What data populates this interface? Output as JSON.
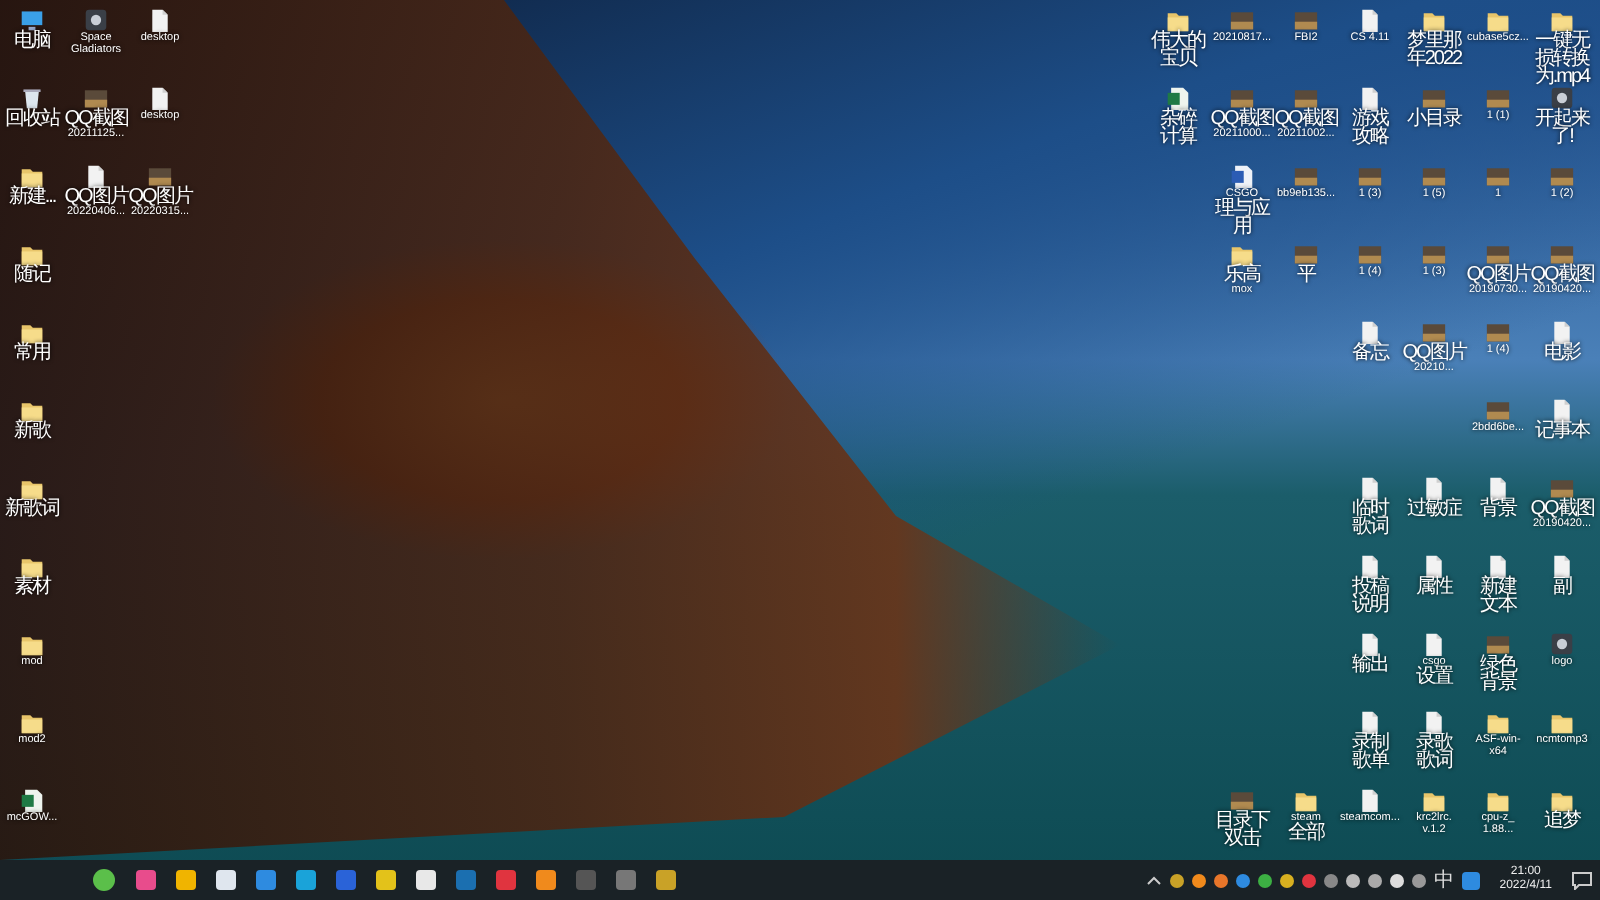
{
  "desktop": {
    "left_rows": [
      [
        {
          "kind": "pc",
          "label": [
            "电脑"
          ]
        },
        {
          "kind": "app",
          "label": [
            "Space",
            "Gladiators"
          ]
        },
        {
          "kind": "file",
          "label": [
            "desktop"
          ]
        }
      ],
      [
        {
          "kind": "bin",
          "label": [
            "回收站"
          ]
        },
        {
          "kind": "image",
          "label": [
            "QQ截图",
            "20211125..."
          ]
        },
        {
          "kind": "file",
          "label": [
            "desktop"
          ]
        }
      ],
      [
        {
          "kind": "folder",
          "label": [
            "新建..."
          ]
        },
        {
          "kind": "file",
          "label": [
            "QQ图片",
            "20220406..."
          ]
        },
        {
          "kind": "image",
          "label": [
            "QQ图片",
            "20220315..."
          ]
        }
      ],
      [
        {
          "kind": "folder",
          "label": [
            "随记"
          ]
        }
      ],
      [
        {
          "kind": "folder",
          "label": [
            "常用"
          ]
        }
      ],
      [
        {
          "kind": "folder",
          "label": [
            "新歌"
          ]
        }
      ],
      [
        {
          "kind": "folder",
          "label": [
            "新歌词"
          ]
        }
      ],
      [
        {
          "kind": "folder",
          "label": [
            "素材"
          ]
        }
      ],
      [
        {
          "kind": "folder",
          "label": [
            "mod"
          ]
        }
      ],
      [
        {
          "kind": "folder",
          "label": [
            "mod2"
          ]
        }
      ],
      [
        {
          "kind": "excel",
          "label": [
            "mcGOW..."
          ]
        }
      ]
    ],
    "right_rows": [
      [
        {
          "kind": "folder",
          "label": [
            "伟大的",
            "宝贝"
          ]
        },
        {
          "kind": "image",
          "label": [
            "20210817..."
          ]
        },
        {
          "kind": "image",
          "label": [
            "FBI2"
          ]
        },
        {
          "kind": "file",
          "label": [
            "CS 4.11"
          ]
        },
        {
          "kind": "folder",
          "label": [
            "梦里那",
            "年2022"
          ]
        },
        {
          "kind": "folder",
          "label": [
            "cubase5cz..."
          ]
        },
        {
          "kind": "folder",
          "label": [
            "一键无",
            "损转换",
            "为.mp4"
          ]
        }
      ],
      [
        {
          "kind": "excel",
          "label": [
            "杂碎",
            "计算"
          ]
        },
        {
          "kind": "image",
          "label": [
            "QQ截图",
            "20211000..."
          ]
        },
        {
          "kind": "image",
          "label": [
            "QQ截图",
            "20211002..."
          ]
        },
        {
          "kind": "file",
          "label": [
            "游戏",
            "攻略"
          ]
        },
        {
          "kind": "image",
          "label": [
            "小目录"
          ]
        },
        {
          "kind": "image",
          "label": [
            "1 (1)"
          ]
        },
        {
          "kind": "app",
          "label": [
            "开起来",
            "了!"
          ]
        }
      ],
      [
        {
          "kind": "gap"
        },
        {
          "kind": "word",
          "label": [
            "CSGO",
            "理与应",
            "用"
          ]
        },
        {
          "kind": "image",
          "label": [
            "bb9eb135..."
          ]
        },
        {
          "kind": "image",
          "label": [
            "1 (3)"
          ]
        },
        {
          "kind": "image",
          "label": [
            "1 (5)"
          ]
        },
        {
          "kind": "image",
          "label": [
            "1"
          ]
        },
        {
          "kind": "image",
          "label": [
            "1 (2)"
          ]
        }
      ],
      [
        {
          "kind": "gap"
        },
        {
          "kind": "folder",
          "label": [
            "乐高",
            "mox"
          ]
        },
        {
          "kind": "image",
          "label": [
            "平"
          ]
        },
        {
          "kind": "image",
          "label": [
            "1 (4)"
          ]
        },
        {
          "kind": "image",
          "label": [
            "1 (3)"
          ]
        },
        {
          "kind": "image",
          "label": [
            "QQ图片",
            "20190730..."
          ]
        },
        {
          "kind": "image",
          "label": [
            "QQ截图",
            "20190420..."
          ]
        }
      ],
      [
        {
          "kind": "gap"
        },
        {
          "kind": "gap"
        },
        {
          "kind": "gap"
        },
        {
          "kind": "file",
          "label": [
            "备忘"
          ]
        },
        {
          "kind": "image",
          "label": [
            "QQ图片",
            "20210..."
          ]
        },
        {
          "kind": "image",
          "label": [
            "1 (4)"
          ]
        },
        {
          "kind": "file",
          "label": [
            "电影"
          ]
        }
      ],
      [
        {
          "kind": "gap"
        },
        {
          "kind": "gap"
        },
        {
          "kind": "gap"
        },
        {
          "kind": "gap"
        },
        {
          "kind": "gap"
        },
        {
          "kind": "image",
          "label": [
            "2bdd6be..."
          ]
        },
        {
          "kind": "file",
          "label": [
            "记事本"
          ]
        }
      ],
      [
        {
          "kind": "gap"
        },
        {
          "kind": "gap"
        },
        {
          "kind": "gap"
        },
        {
          "kind": "file",
          "label": [
            "临时",
            "歌词"
          ]
        },
        {
          "kind": "file",
          "label": [
            "过敏症"
          ]
        },
        {
          "kind": "file",
          "label": [
            "背景"
          ]
        },
        {
          "kind": "image",
          "label": [
            "QQ截图",
            "20190420..."
          ]
        }
      ],
      [
        {
          "kind": "gap"
        },
        {
          "kind": "gap"
        },
        {
          "kind": "gap"
        },
        {
          "kind": "file",
          "label": [
            "投稿",
            "说明"
          ]
        },
        {
          "kind": "file",
          "label": [
            "属性"
          ]
        },
        {
          "kind": "file",
          "label": [
            "新建",
            "文本"
          ]
        },
        {
          "kind": "file",
          "label": [
            "副"
          ]
        }
      ],
      [
        {
          "kind": "gap"
        },
        {
          "kind": "gap"
        },
        {
          "kind": "gap"
        },
        {
          "kind": "file",
          "label": [
            "输出"
          ]
        },
        {
          "kind": "file",
          "label": [
            "csgo",
            "设置"
          ]
        },
        {
          "kind": "image",
          "label": [
            "绿色",
            "背景"
          ]
        },
        {
          "kind": "app",
          "label": [
            "logo"
          ]
        }
      ],
      [
        {
          "kind": "gap"
        },
        {
          "kind": "gap"
        },
        {
          "kind": "gap"
        },
        {
          "kind": "file",
          "label": [
            "录制",
            "歌单"
          ]
        },
        {
          "kind": "file",
          "label": [
            "录歌",
            "歌词"
          ]
        },
        {
          "kind": "folder",
          "label": [
            "ASF-win-",
            "x64"
          ]
        },
        {
          "kind": "folder",
          "label": [
            "ncmtomp3"
          ]
        }
      ],
      [
        {
          "kind": "gap"
        },
        {
          "kind": "image",
          "label": [
            "目录下",
            "双击"
          ]
        },
        {
          "kind": "folder",
          "label": [
            "steam",
            "全部"
          ]
        },
        {
          "kind": "file",
          "label": [
            "steamcom..."
          ]
        },
        {
          "kind": "folder",
          "label": [
            "krc2lrc.",
            "v.1.2"
          ]
        },
        {
          "kind": "folder",
          "label": [
            "cpu-z_",
            "1.88..."
          ]
        },
        {
          "kind": "folder",
          "label": [
            "追梦"
          ]
        }
      ]
    ]
  },
  "taskbar": {
    "ime": "中",
    "time": "21:00",
    "date": "2022/4/11"
  }
}
